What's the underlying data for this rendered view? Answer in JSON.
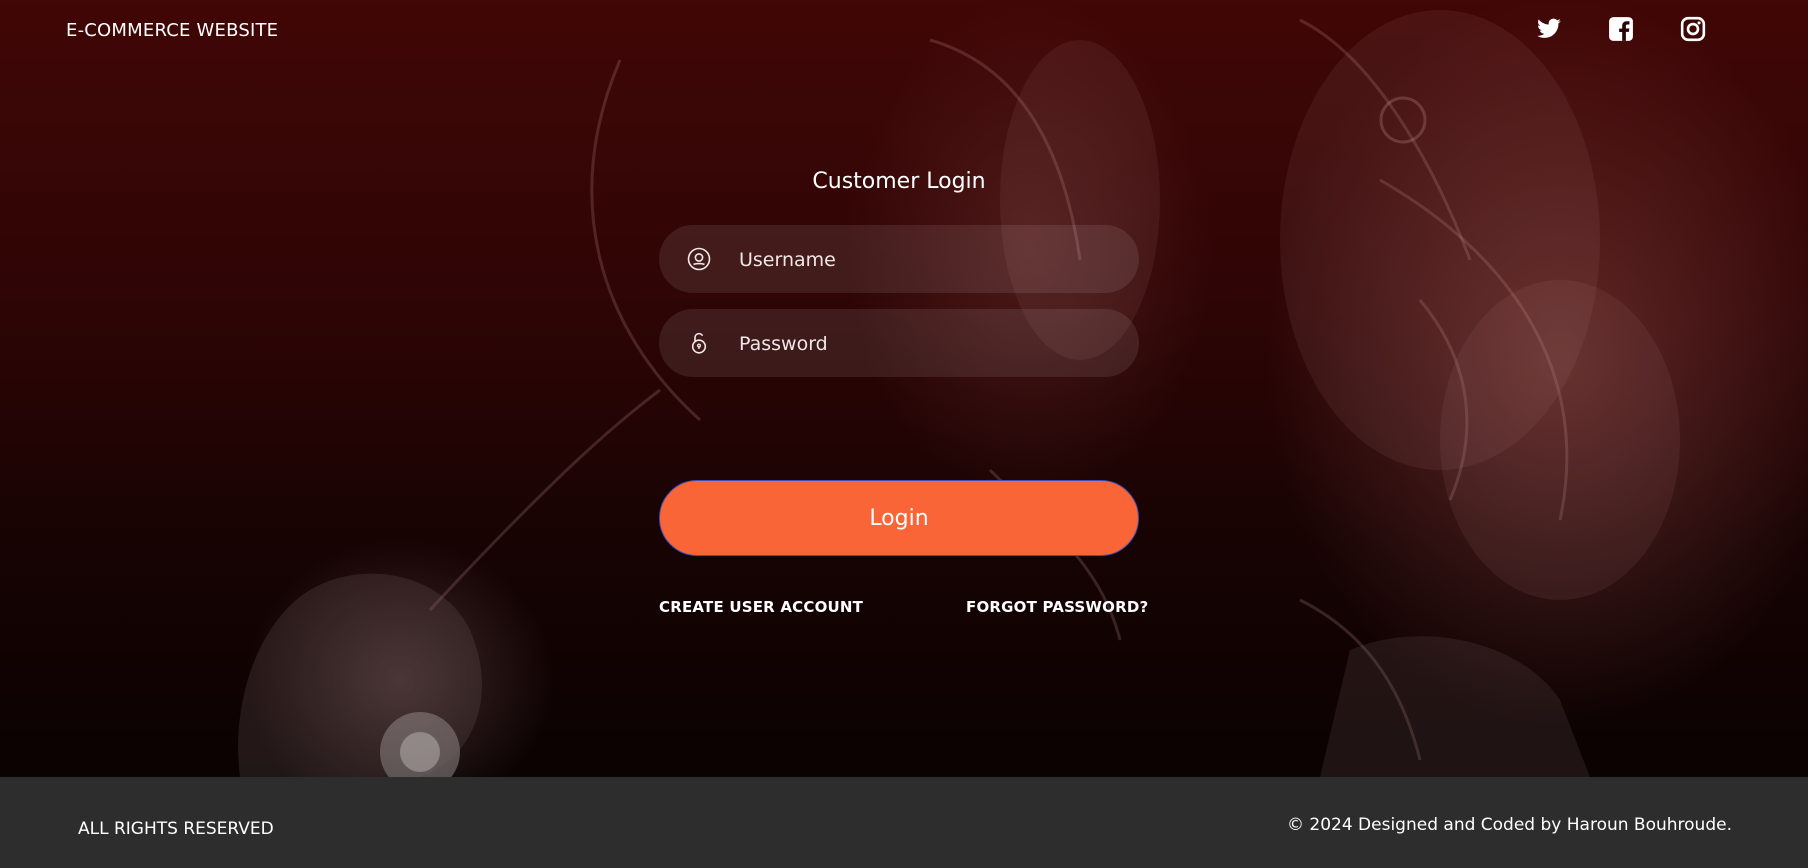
{
  "header": {
    "brand": "E-COMMERCE WEBSITE",
    "socials": [
      {
        "name": "twitter",
        "icon": "twitter-icon"
      },
      {
        "name": "facebook",
        "icon": "facebook-icon"
      },
      {
        "name": "instagram",
        "icon": "instagram-icon"
      }
    ]
  },
  "login": {
    "title": "Customer Login",
    "username_placeholder": "Username",
    "password_placeholder": "Password",
    "username_icon": "user-circle-icon",
    "password_icon": "unlocked-padlock-icon",
    "submit_label": "Login",
    "create_account_label": "CREATE USER ACCOUNT",
    "forgot_password_label": "FORGOT PASSWORD?"
  },
  "footer": {
    "left_text": "ALL RIGHTS RESERVED",
    "right_text": "© 2024 Designed and Coded by Haroun Bouhroude."
  },
  "colors": {
    "accent": "#f96536",
    "footer_bg": "#2d2d2d",
    "hero_top": "#410606",
    "hero_bottom": "#0b0202",
    "text": "#ffffff"
  }
}
